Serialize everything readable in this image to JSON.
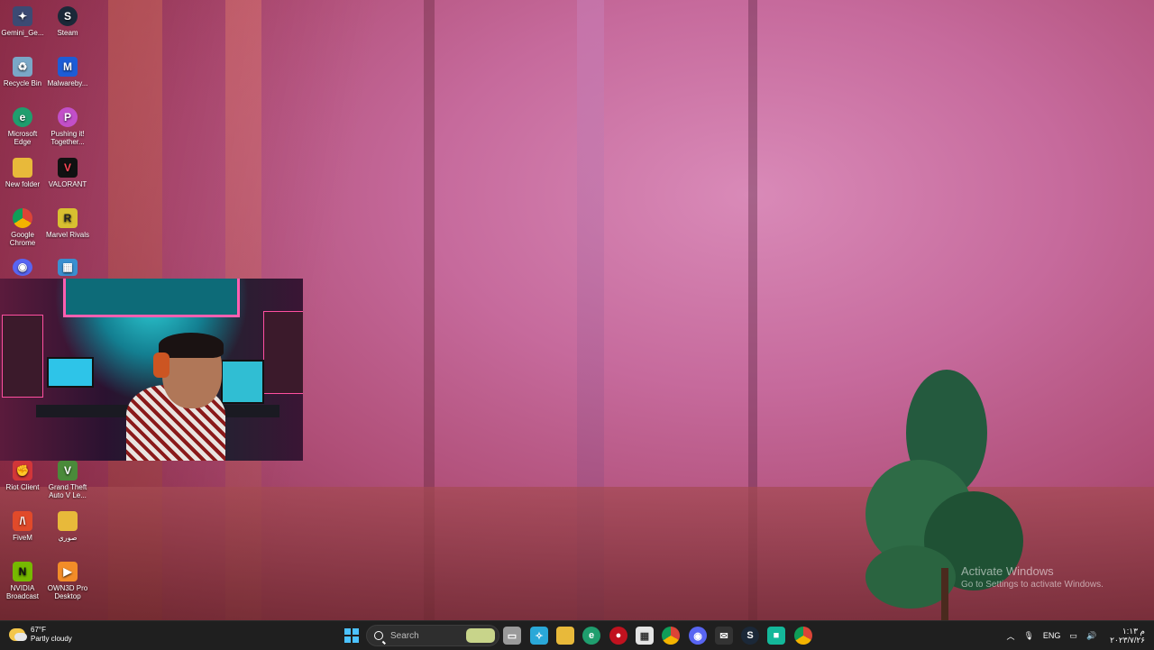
{
  "desktop": {
    "icons": [
      {
        "label": "Gemini_Ge...",
        "icon": "gemini-shortcut-icon",
        "color": "#3c4a73"
      },
      {
        "label": "Steam",
        "icon": "steam-icon",
        "color": "#1b2838"
      },
      {
        "label": "Recycle Bin",
        "icon": "recycle-bin-icon",
        "color": "#7aa7c7"
      },
      {
        "label": "Malwareby...",
        "icon": "malwarebytes-icon",
        "color": "#1d5cd6"
      },
      {
        "label": "Microsoft Edge",
        "icon": "edge-icon",
        "color": "#1f9e6e"
      },
      {
        "label": "Pushing it! Together...",
        "icon": "pushing-it-icon",
        "color": "#c24fc9"
      },
      {
        "label": "New folder",
        "icon": "folder-icon",
        "color": "#e8b93a"
      },
      {
        "label": "VALORANT",
        "icon": "valorant-icon",
        "color": "#111111"
      },
      {
        "label": "Google Chrome",
        "icon": "chrome-icon",
        "color": "#db4437"
      },
      {
        "label": "Marvel Rivals",
        "icon": "marvel-rivals-icon",
        "color": "#d8c030"
      },
      {
        "label": "",
        "icon": "discord-icon",
        "color": "#5865f2"
      },
      {
        "label": "",
        "icon": "game-shortcut-icon",
        "color": "#3a8fd0"
      },
      {
        "label": "Riot Client",
        "icon": "riot-client-icon",
        "color": "#d13639"
      },
      {
        "label": "Grand Theft Auto V Le...",
        "icon": "gta-v-icon",
        "color": "#4a8a3a"
      },
      {
        "label": "FiveM",
        "icon": "fivem-icon",
        "color": "#e14a2a"
      },
      {
        "label": "صوري",
        "icon": "folder-icon",
        "color": "#e8b93a"
      },
      {
        "label": "NVIDIA Broadcast",
        "icon": "nvidia-broadcast-icon",
        "color": "#76b900"
      },
      {
        "label": "OWN3D Pro Desktop",
        "icon": "own3d-icon",
        "color": "#f28c28"
      }
    ]
  },
  "watermark": {
    "title": "Activate Windows",
    "subtitle": "Go to Settings to activate Windows."
  },
  "taskbar": {
    "weather": {
      "temp": "67°F",
      "desc": "Partly cloudy"
    },
    "search_placeholder": "Search",
    "pinned": [
      {
        "icon": "task-view-icon",
        "color": "#9a9a9a"
      },
      {
        "icon": "copilot-icon",
        "color": "#2aa8d8"
      },
      {
        "icon": "file-explorer-icon",
        "color": "#e8b93a"
      },
      {
        "icon": "edge-icon",
        "color": "#1f9e6e"
      },
      {
        "icon": "record-app-icon",
        "color": "#c1121f"
      },
      {
        "icon": "microsoft-store-icon",
        "color": "#e4e4e4"
      },
      {
        "icon": "chrome-icon",
        "color": "#db4437"
      },
      {
        "icon": "discord-icon",
        "color": "#5865f2"
      },
      {
        "icon": "email-icon",
        "color": "#333333"
      },
      {
        "icon": "steam-icon",
        "color": "#1b2838"
      },
      {
        "icon": "app-icon",
        "color": "#14b89a"
      },
      {
        "icon": "chrome-icon",
        "color": "#db4437"
      }
    ],
    "tray": {
      "lang": "ENG",
      "time": "۱:۱۳ م",
      "date": "۲۰۲۳/۷/۲۶"
    }
  }
}
